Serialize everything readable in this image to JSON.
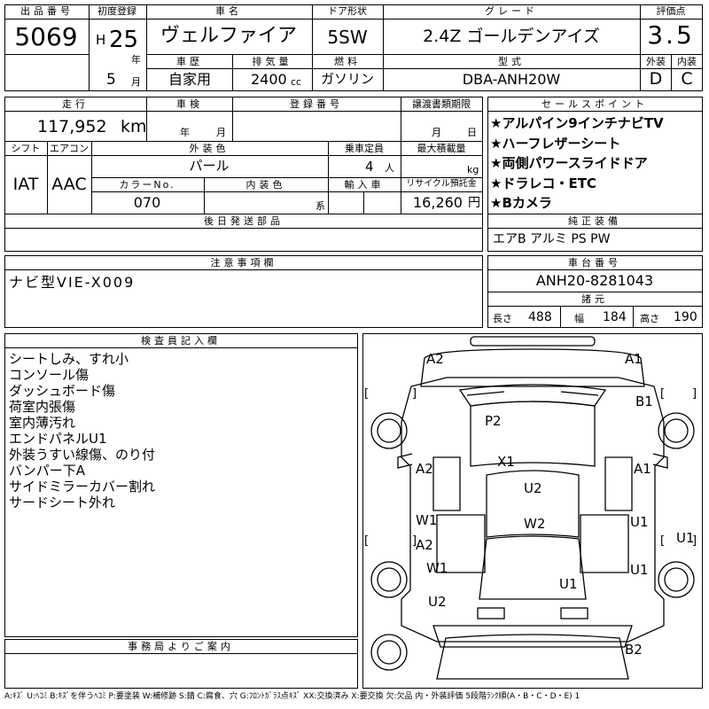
{
  "top": {
    "lot_no_label": "出品番号",
    "lot_no": "5069",
    "first_reg_label": "初度登録",
    "era": "H",
    "year_value": "25",
    "year_unit": "年",
    "month_value": "5",
    "month_unit": "月",
    "car_name_label": "車名",
    "car_name": "ヴェルファイア",
    "door_label": "ドア形状",
    "door": "5SW",
    "grade_label": "グレード",
    "grade": "2.4Z ゴールデンアイズ",
    "score_label": "評価点",
    "score": "3.5",
    "history_label": "車歴",
    "history": "自家用",
    "displacement_label": "排気量",
    "displacement": "2400",
    "displacement_unit": "cc",
    "fuel_label": "燃料",
    "fuel": "ガソリン",
    "model_label": "型式",
    "model": "DBA-ANH20W",
    "exterior_label": "外装",
    "exterior_grade": "D",
    "interior_label": "内装",
    "interior_grade": "C"
  },
  "middle": {
    "mileage_label": "走行",
    "mileage": "117,952",
    "mileage_unit": "km",
    "inspection_label": "車検",
    "inspection_year": "年",
    "inspection_month": "月",
    "reg_no_label": "登録番号",
    "transfer_deadline_label": "譲渡書類期限",
    "transfer_month": "月",
    "transfer_day": "日",
    "shift_label": "シフト",
    "shift": "IAT",
    "aircon_label": "エアコン",
    "aircon": "AAC",
    "ext_color_label": "外装色",
    "ext_color": "パール",
    "capacity_label": "乗車定員",
    "capacity": "4",
    "capacity_unit": "人",
    "max_load_label": "最大積載量",
    "max_load_unit": "kg",
    "color_no_label": "カラーNo.",
    "color_no": "070",
    "int_color_label": "内装色",
    "int_color_unit": "系",
    "import_label": "輸入車",
    "recycle_label": "リサイクル預託金",
    "recycle": "16,260",
    "recycle_unit": "円",
    "later_parts_label": "後日発送部品"
  },
  "sales_points": {
    "label": "セールスポイント",
    "items": [
      "★アルパイン9インチナビTV",
      "★ハーフレザーシート",
      "★両側パワースライドドア",
      "★ドラレコ・ETC",
      "★Bカメラ"
    ]
  },
  "equipment": {
    "label": "純正装備",
    "value": "エアB アルミ PS PW"
  },
  "notes": {
    "label": "注意事項欄",
    "text": "ナビ型VIE-X009"
  },
  "chassis": {
    "label": "車台番号",
    "value": "ANH20-8281043",
    "dims_label": "諸元",
    "length_label": "長さ",
    "length": "488",
    "width_label": "幅",
    "width": "184",
    "height_label": "高さ",
    "height": "190"
  },
  "inspector": {
    "label": "検査員記入欄",
    "lines": [
      "シートしみ、すれ小",
      "コンソール傷",
      "ダッシュボード傷",
      "荷室内張傷",
      "室内薄汚れ",
      "エンドパネルU1",
      "外装うすい線傷、のり付",
      "バンパー下A",
      "サイドミラーカバー割れ",
      "サードシート外れ"
    ]
  },
  "office": {
    "label": "事務局よりご案内"
  },
  "diagram": {
    "marks": [
      "A2",
      "A1",
      "B1",
      "P2",
      "X1",
      "A2",
      "A1",
      "U2",
      "W1",
      "W2",
      "U1",
      "U1",
      "A2",
      "W1",
      "U1",
      "U1",
      "U2",
      "B2"
    ],
    "brackets": [
      "[",
      "]",
      "[",
      "]",
      "[",
      "]",
      "[",
      "]"
    ]
  },
  "legend": "A:ｷｽﾞ U:ﾍｺﾐ B:ｷｽﾞを伴うﾍｺﾐ P:要塗装 W:補修跡 S:錆 C:腐食、穴 G:ﾌﾛﾝﾄｶﾞﾗｽ点ｷｽﾞ XX:交換済み X:要交換 欠:欠品 内・外装評価 5段階ﾗﾝｸ順(A・B・C・D・E) 1"
}
